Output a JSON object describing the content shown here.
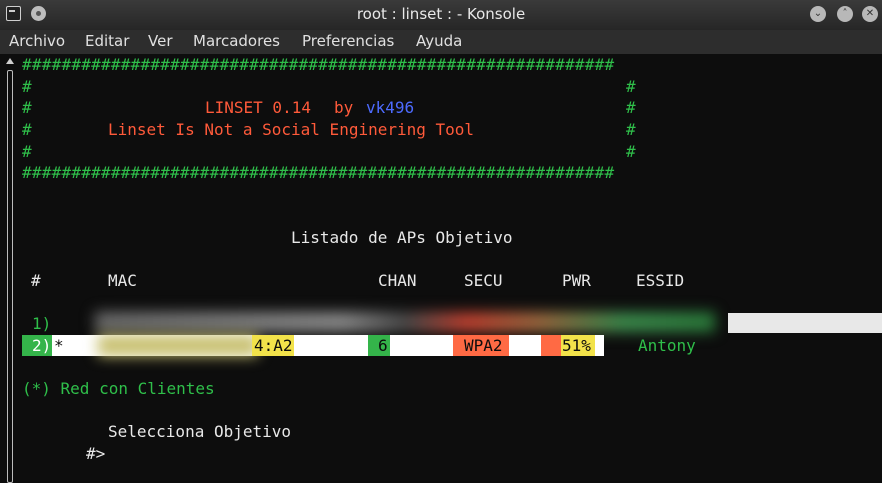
{
  "window": {
    "title": "root : linset : - Konsole"
  },
  "menu": [
    "Archivo",
    "Editar",
    "Ver",
    "Marcadores",
    "Preferencias",
    "Ayuda"
  ],
  "banner": {
    "border": "############################################################",
    "side": "#",
    "name": "LINSET 0.14",
    "by": "by",
    "author": "vk496",
    "subtitle": "Linset Is Not a Social Enginering Tool"
  },
  "list": {
    "heading": "Listado de APs Objetivo",
    "columns": [
      "#",
      "MAC",
      "CHAN",
      "SECU",
      "PWR",
      "ESSID"
    ],
    "row1": {
      "num": "1)"
    },
    "row2": {
      "num": "2)",
      "mark": "*",
      "mac": "4:A2",
      "chan": "6",
      "secu": "WPA2",
      "pwr": "51%",
      "essid": "Antony"
    }
  },
  "footer_note": "(*) Red con Clientes",
  "select_label": "Selecciona Objetivo",
  "prompt": "#>",
  "colors": {
    "green": "#2fbf4a",
    "red": "#ff5a3a",
    "blue": "#4d6bff",
    "chan_bg": "#34b44a",
    "secu_bg": "#ff6a44",
    "pwr_bg": "#f2e24a"
  }
}
